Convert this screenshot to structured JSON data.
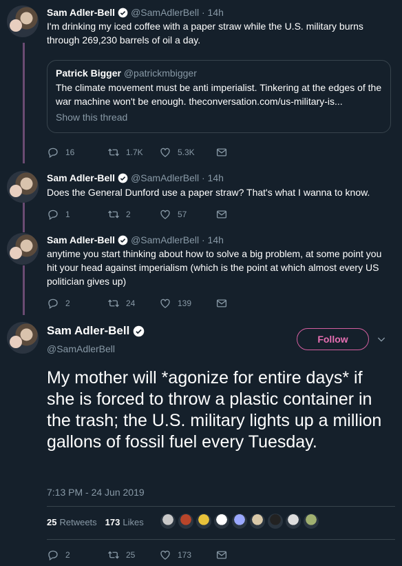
{
  "colors": {
    "background": "#15202b",
    "secondary_text": "#8899a6",
    "thread_line": "#6a4b72",
    "follow_border": "#d45fa0",
    "verified": "#ffffff"
  },
  "tweets": [
    {
      "name": "Sam Adler-Bell",
      "handle": "@SamAdlerBell · 14h",
      "text": "I'm drinking my iced coffee with a paper straw while the U.S. military burns through 269,230 barrels of oil a day.",
      "quote": {
        "name": "Patrick Bigger",
        "handle": "@patrickmbigger",
        "text": "The climate movement must be anti imperialist. Tinkering at the edges of the war machine won't be enough. theconversation.com/us-military-is...",
        "show_thread": "Show this thread"
      },
      "replies": "16",
      "retweets": "1.7K",
      "likes": "5.3K"
    },
    {
      "name": "Sam Adler-Bell",
      "handle": "@SamAdlerBell · 14h",
      "text": "Does the General Dunford use a paper straw? That's what I wanna to know.",
      "replies": "1",
      "retweets": "2",
      "likes": "57"
    },
    {
      "name": "Sam Adler-Bell",
      "handle": "@SamAdlerBell · 14h",
      "text": "anytime you start thinking about how to solve a big problem, at some point you hit your head against imperialism (which is the point at which almost every US politician gives up)",
      "replies": "2",
      "retweets": "24",
      "likes": "139"
    }
  ],
  "main_tweet": {
    "name": "Sam Adler-Bell",
    "handle": "@SamAdlerBell",
    "follow_label": "Follow",
    "text": "My mother will *agonize for entire days* if she is forced to throw a plastic container in the trash; the U.S. military lights up a million gallons of fossil fuel every Tuesday.",
    "timestamp": "7:13 PM - 24 Jun 2019",
    "retweets_count": "25",
    "retweets_label": "Retweets",
    "likes_count": "173",
    "likes_label": "Likes",
    "replies": "2",
    "retweets": "25",
    "likes": "173",
    "liker_colors": [
      "#c9c9c9",
      "#b8452a",
      "#e8c23a",
      "#ffffff",
      "#9aa8ff",
      "#d8c8a8",
      "#222222",
      "#dddddd",
      "#a0b070"
    ]
  }
}
